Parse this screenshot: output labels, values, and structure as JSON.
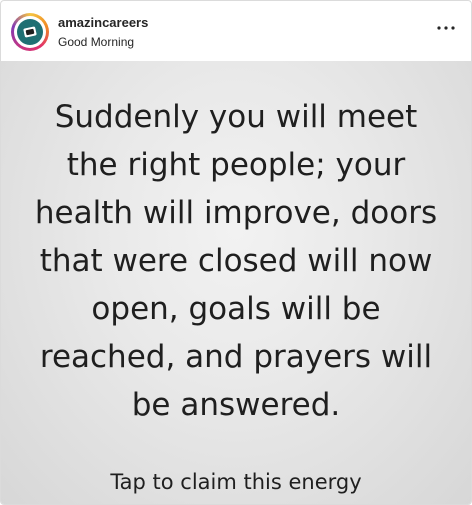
{
  "post": {
    "username": "amazincareers",
    "subtitle": "Good Morning",
    "avatar_icon": "brand-logo-icon",
    "more_icon": "more-options-icon",
    "quote_lines": [
      "Suddenly you will meet",
      "the right people; your",
      "health will improve, doors",
      "that were closed will now",
      "open, goals will be",
      "reached, and prayers will",
      "be answered."
    ],
    "cta": "Tap to claim this energy"
  },
  "colors": {
    "text": "#262626",
    "avatar_ring_start": "#f5c542",
    "avatar_ring_end": "#c13584",
    "avatar_fill": "#1f6f73"
  }
}
